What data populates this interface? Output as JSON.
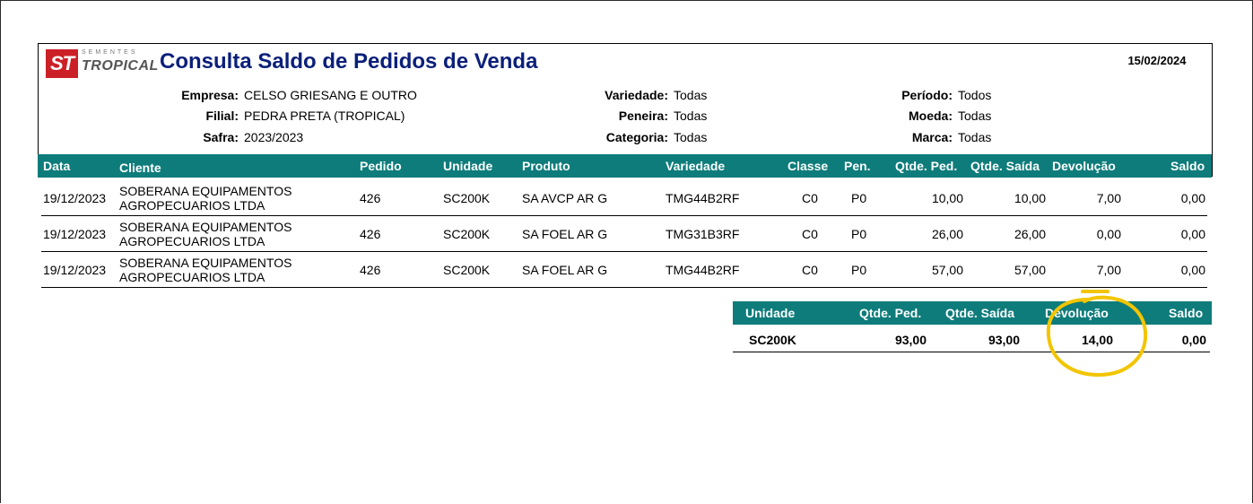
{
  "header": {
    "logo_small": "SEMENTES",
    "logo_text": "TROPICAL",
    "logo_badge": "ST",
    "title": "Consulta Saldo de Pedidos de Venda",
    "date": "15/02/2024"
  },
  "filters": {
    "empresa_label": "Empresa:",
    "empresa": "CELSO GRIESANG E OUTRO",
    "filial_label": "Filial:",
    "filial": "PEDRA PRETA (TROPICAL)",
    "safra_label": "Safra:",
    "safra": "2023/2023",
    "variedade_label": "Variedade:",
    "variedade": "Todas",
    "peneira_label": "Peneira:",
    "peneira": "Todas",
    "categoria_label": "Categoria:",
    "categoria": "Todas",
    "periodo_label": "Período:",
    "periodo": "Todos",
    "moeda_label": "Moeda:",
    "moeda": "Todas",
    "marca_label": "Marca:",
    "marca": "Todas"
  },
  "table": {
    "columns": [
      "Data",
      "Cliente",
      "Pedido",
      "Unidade",
      "Produto",
      "Variedade",
      "Classe",
      "Pen.",
      "Qtde. Ped.",
      "Qtde. Saída",
      "Devolução",
      "Saldo"
    ],
    "rows": [
      {
        "data": "19/12/2023",
        "cliente1": "SOBERANA EQUIPAMENTOS",
        "cliente2": "AGROPECUARIOS LTDA",
        "pedido": "426",
        "unidade": "SC200K",
        "produto": "SA AVCP AR G",
        "variedade": "TMG44B2RF",
        "classe": "C0",
        "pen": "P0",
        "qtde_ped": "10,00",
        "qtde_saida": "10,00",
        "devolucao": "7,00",
        "saldo": "0,00"
      },
      {
        "data": "19/12/2023",
        "cliente1": "SOBERANA EQUIPAMENTOS",
        "cliente2": "AGROPECUARIOS LTDA",
        "pedido": "426",
        "unidade": "SC200K",
        "produto": "SA FOEL AR G",
        "variedade": "TMG31B3RF",
        "classe": "C0",
        "pen": "P0",
        "qtde_ped": "26,00",
        "qtde_saida": "26,00",
        "devolucao": "0,00",
        "saldo": "0,00"
      },
      {
        "data": "19/12/2023",
        "cliente1": "SOBERANA EQUIPAMENTOS",
        "cliente2": "AGROPECUARIOS LTDA",
        "pedido": "426",
        "unidade": "SC200K",
        "produto": "SA FOEL AR G",
        "variedade": "TMG44B2RF",
        "classe": "C0",
        "pen": "P0",
        "qtde_ped": "57,00",
        "qtde_saida": "57,00",
        "devolucao": "7,00",
        "saldo": "0,00"
      }
    ]
  },
  "summary": {
    "columns": [
      "Unidade",
      "Qtde. Ped.",
      "Qtde. Saída",
      "Devolução",
      "Saldo"
    ],
    "row": {
      "unidade": "SC200K",
      "qtde_ped": "93,00",
      "qtde_saida": "93,00",
      "devolucao": "14,00",
      "saldo": "0,00"
    }
  },
  "colors": {
    "header_bg": "#0e7c7b",
    "title": "#0a1f7a",
    "highlight": "#f2c500"
  }
}
